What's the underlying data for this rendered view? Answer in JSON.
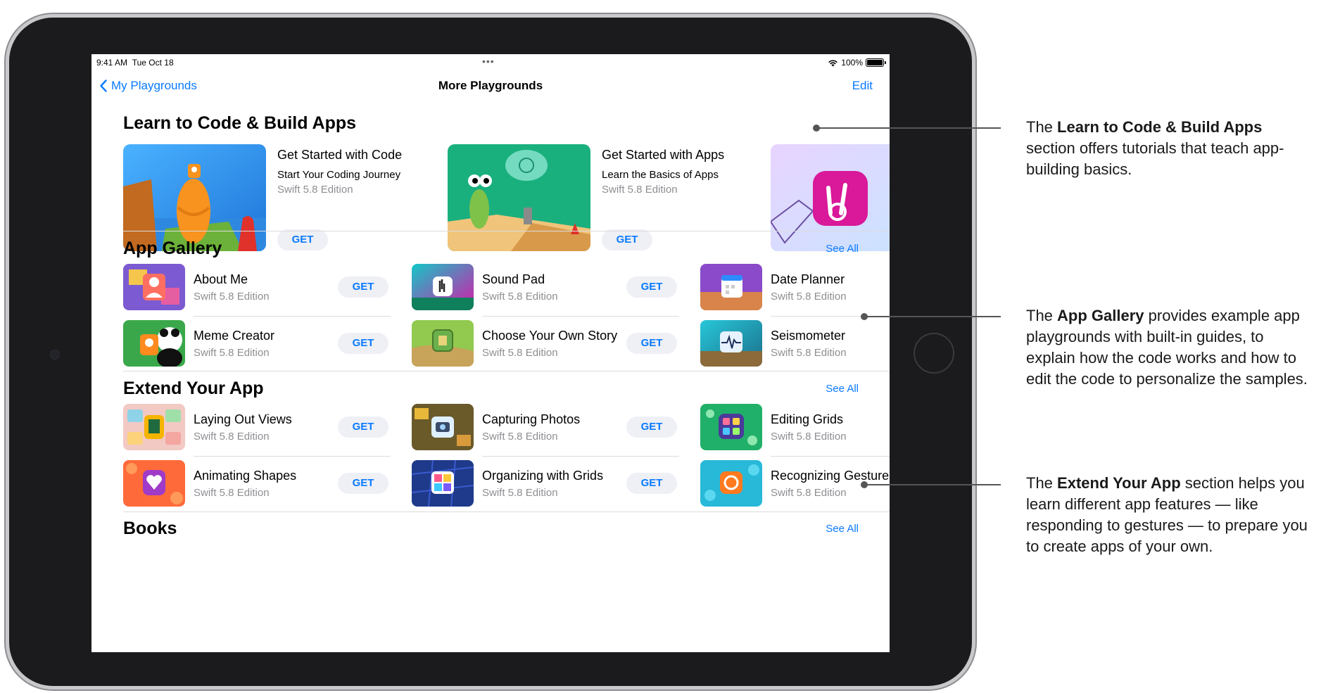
{
  "status": {
    "time": "9:41 AM",
    "date": "Tue Oct 18",
    "battery": "100%"
  },
  "nav": {
    "back_label": "My Playgrounds",
    "title": "More Playgrounds",
    "edit_label": "Edit"
  },
  "sections": {
    "learn": {
      "title": "Learn to Code & Build Apps"
    },
    "gallery": {
      "title": "App Gallery",
      "see_all": "See All"
    },
    "extend": {
      "title": "Extend Your App",
      "see_all": "See All"
    },
    "books": {
      "title": "Books",
      "see_all": "See All"
    }
  },
  "get_label": "GET",
  "features": [
    {
      "name": "Get Started with Code",
      "subtitle": "Start Your Coding Journey",
      "edition": "Swift 5.8 Edition"
    },
    {
      "name": "Get Started with Apps",
      "subtitle": "Learn the Basics of Apps",
      "edition": "Swift 5.8 Edition"
    }
  ],
  "gallery_items": [
    {
      "name": "About Me",
      "edition": "Swift 5.8 Edition"
    },
    {
      "name": "Sound Pad",
      "edition": "Swift 5.8 Edition"
    },
    {
      "name": "Date Planner",
      "edition": "Swift 5.8 Edition"
    },
    {
      "name": "Meme Creator",
      "edition": "Swift 5.8 Edition"
    },
    {
      "name": "Choose Your Own Story",
      "edition": "Swift 5.8 Edition"
    },
    {
      "name": "Seismometer",
      "edition": "Swift 5.8 Edition"
    }
  ],
  "extend_items": [
    {
      "name": "Laying Out Views",
      "edition": "Swift 5.8 Edition"
    },
    {
      "name": "Capturing Photos",
      "edition": "Swift 5.8 Edition"
    },
    {
      "name": "Editing Grids",
      "edition": "Swift 5.8 Edition"
    },
    {
      "name": "Animating Shapes",
      "edition": "Swift 5.8 Edition"
    },
    {
      "name": "Organizing with Grids",
      "edition": "Swift 5.8 Edition"
    },
    {
      "name": "Recognizing Gestures",
      "edition": "Swift 5.8 Edition"
    }
  ],
  "annotations": {
    "learn": {
      "pre": "The ",
      "bold": "Learn to Code & Build Apps",
      "post": " section offers tutorials that teach app-building basics."
    },
    "gallery": {
      "pre": "The ",
      "bold": "App Gallery",
      "post": " provides example app playgrounds with built-in guides, to explain how the code works and how to edit the code to personalize the samples."
    },
    "extend": {
      "pre": "The ",
      "bold": "Extend Your App",
      "post": " section helps you learn different app features — like responding to gestures — to prepare you to create apps of your own."
    }
  },
  "colors": {
    "accent": "#0a7aff",
    "frame": "#1b1b1d",
    "secondary_text": "#8e8e93",
    "button_bg": "#eef0f5"
  }
}
